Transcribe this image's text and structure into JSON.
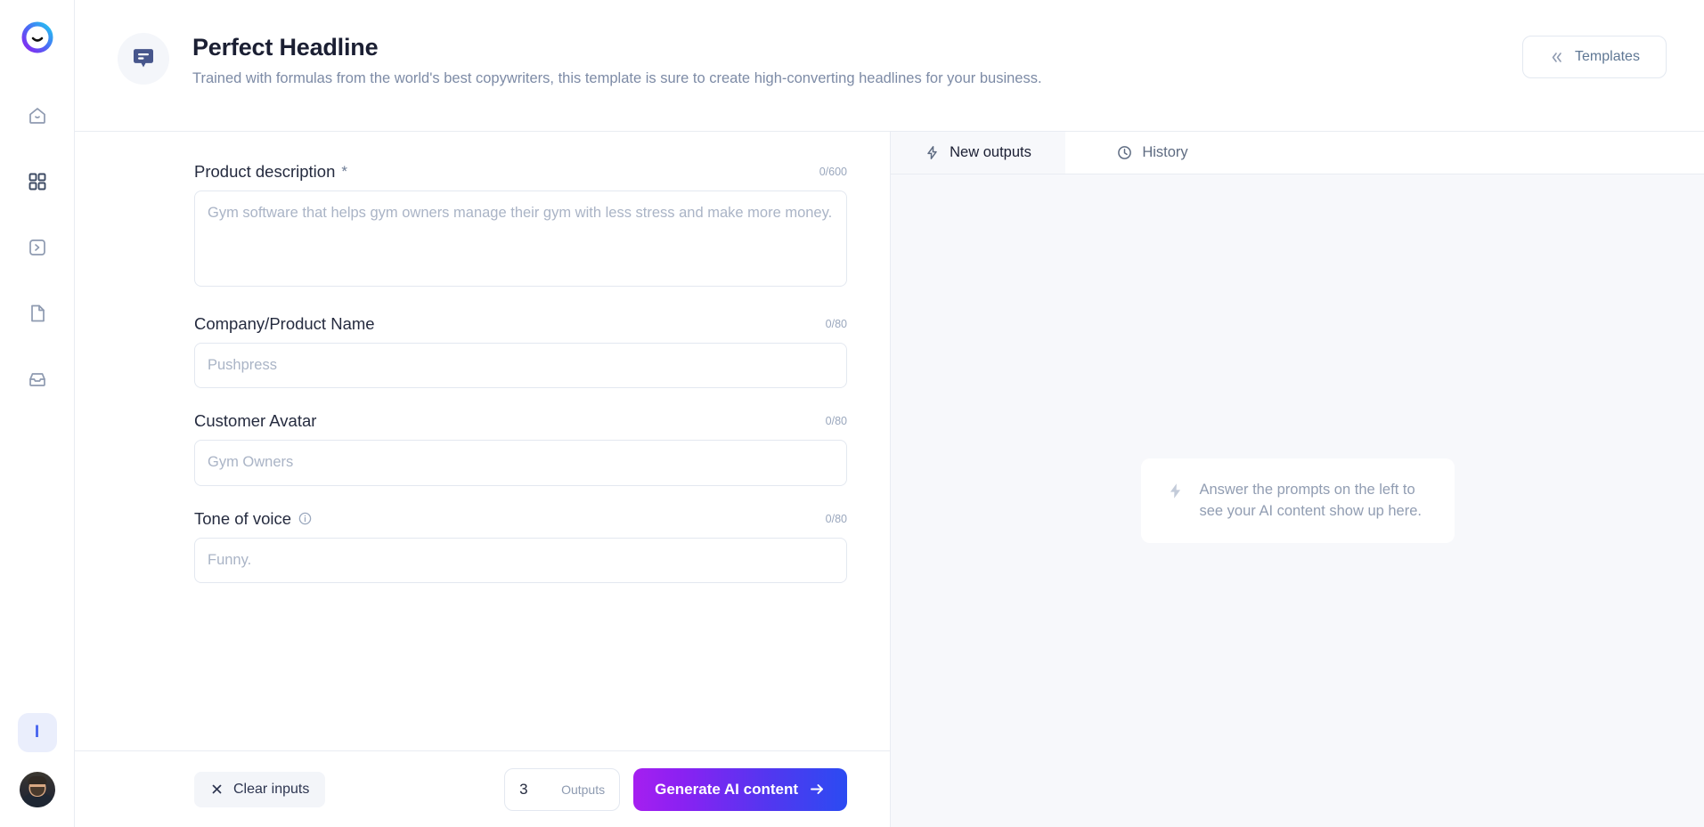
{
  "sidebar": {
    "logo_name": "app-logo",
    "items": [
      {
        "name": "home",
        "icon": "home-icon"
      },
      {
        "name": "templates",
        "icon": "grid-icon"
      },
      {
        "name": "commands",
        "icon": "terminal-icon"
      },
      {
        "name": "documents",
        "icon": "document-icon"
      },
      {
        "name": "inbox",
        "icon": "inbox-icon"
      }
    ],
    "badge_label": "I",
    "avatar_name": "user-avatar"
  },
  "header": {
    "icon": "speech-bubble-icon",
    "title": "Perfect Headline",
    "subtitle": "Trained with formulas from the world's best copywriters, this template is sure to create high-converting headlines for your business.",
    "templates_button": "Templates",
    "templates_icon": "chevron-double-left-icon"
  },
  "form": {
    "fields": [
      {
        "label": "Product description",
        "required": "*",
        "counter": "0/600",
        "placeholder": "Gym software that helps gym owners manage their gym with less stress and make more money.",
        "value": "",
        "type": "textarea",
        "has_info": false
      },
      {
        "label": "Company/Product Name",
        "required": "",
        "counter": "0/80",
        "placeholder": "Pushpress",
        "value": "",
        "type": "text",
        "has_info": false
      },
      {
        "label": "Customer Avatar",
        "required": "",
        "counter": "0/80",
        "placeholder": "Gym Owners",
        "value": "",
        "type": "text",
        "has_info": false
      },
      {
        "label": "Tone of voice",
        "required": "",
        "counter": "0/80",
        "placeholder": "Funny.",
        "value": "",
        "type": "text",
        "has_info": true
      }
    ],
    "footer": {
      "clear_label": "Clear inputs",
      "clear_icon": "close-x-icon",
      "outputs_value": "3",
      "outputs_label": "Outputs",
      "generate_label": "Generate AI content",
      "generate_icon": "arrow-right-icon"
    }
  },
  "output_panel": {
    "tabs": [
      {
        "label": "New outputs",
        "icon": "lightning-icon",
        "active": true
      },
      {
        "label": "History",
        "icon": "clock-icon",
        "active": false
      }
    ],
    "empty_state": {
      "icon": "lightning-icon",
      "text": "Answer the prompts on the left to see your AI content show up here."
    }
  },
  "colors": {
    "accent_blue": "#4361ee",
    "gradient_start": "#a51ff0",
    "gradient_end": "#2b4bf2",
    "icon_gray": "#8e9ab0",
    "text_dark": "#1b1f33",
    "text_muted": "#7d8ba6"
  }
}
